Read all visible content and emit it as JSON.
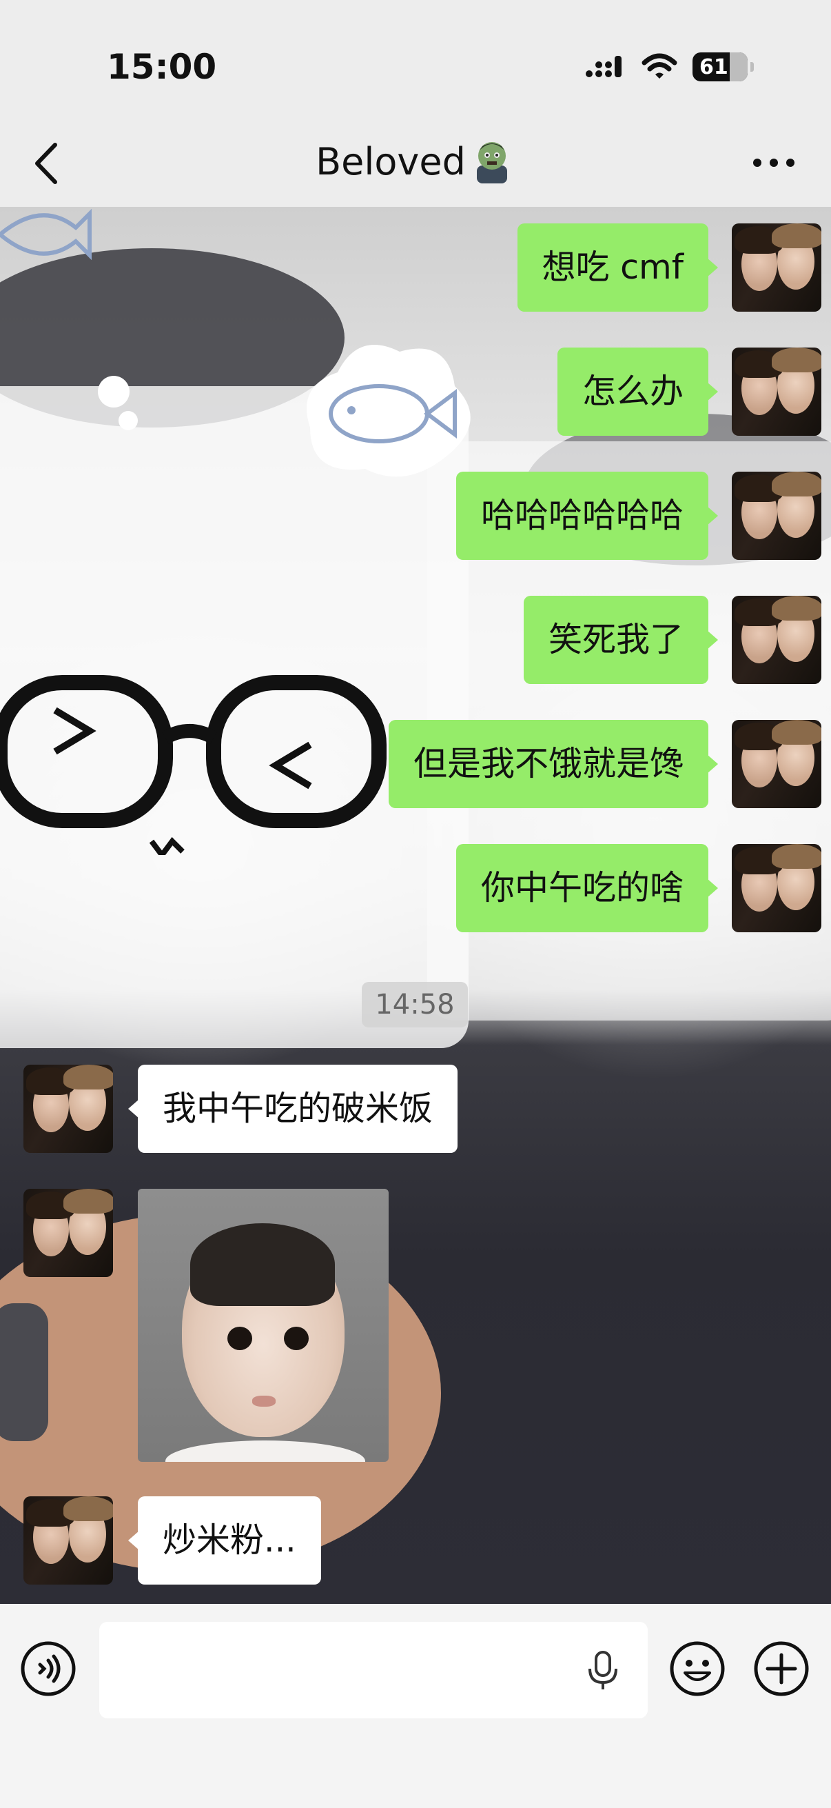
{
  "status_bar": {
    "time": "15:00",
    "battery_level": "61",
    "icons": [
      "signal-icon",
      "wifi-icon",
      "battery-icon"
    ]
  },
  "nav": {
    "title": "Beloved",
    "title_emoji": "zombie-emoji",
    "icons": [
      "back-chevron-icon",
      "more-dots-icon"
    ]
  },
  "messages": [
    {
      "side": "right",
      "type": "text",
      "text": "想吃 cmf"
    },
    {
      "side": "right",
      "type": "text",
      "text": "怎么办"
    },
    {
      "side": "right",
      "type": "text",
      "text": "哈哈哈哈哈哈"
    },
    {
      "side": "right",
      "type": "text",
      "text": "笑死我了"
    },
    {
      "side": "right",
      "type": "text",
      "text": "但是我不饿就是馋"
    },
    {
      "side": "right",
      "type": "text",
      "text": "你中午吃的啥"
    },
    {
      "side": "left",
      "type": "text",
      "text": "我中午吃的破米饭"
    },
    {
      "side": "left",
      "type": "image",
      "image": "baby-photo-sticker"
    },
    {
      "side": "left",
      "type": "text",
      "text": "炒米粉..."
    }
  ],
  "timestamp": "14:58",
  "input": {
    "value": "",
    "placeholder": "",
    "icons": [
      "voice-mode-icon",
      "microphone-icon",
      "emoji-icon",
      "add-plus-icon"
    ]
  },
  "colors": {
    "sent_bubble": "#95ec69",
    "received_bubble": "#ffffff",
    "chrome": "#ededed"
  }
}
